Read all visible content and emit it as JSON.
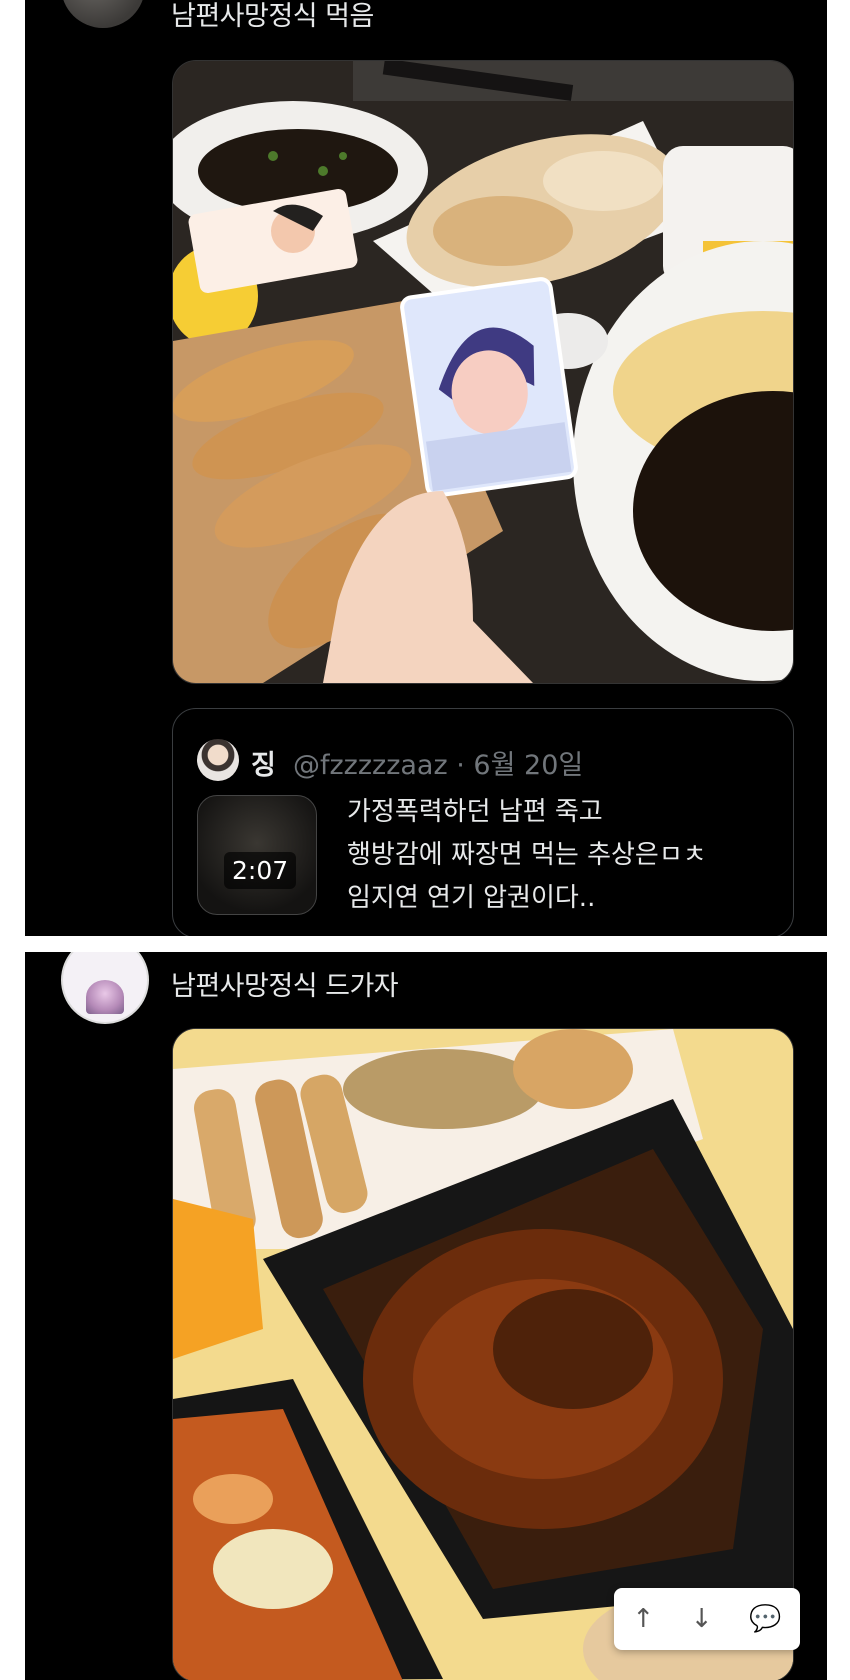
{
  "post1": {
    "text": "남편사망정식 먹음",
    "photo_subject": "food",
    "quote": {
      "name": "징",
      "handle": "@fzzzzzaaz",
      "separator": "·",
      "date": "6월 20일",
      "video_duration": "2:07",
      "lines": [
        "가정폭력하던 남편 죽고",
        "행방감에 짜장면 먹는 추상은ㅁㅊ",
        "임지연 연기 압권이다.."
      ]
    }
  },
  "post2": {
    "text": "남편사망정식 드가자",
    "photo_subject": "food"
  },
  "action_bar": {
    "up_icon": "arrow-up-icon",
    "down_icon": "arrow-down-icon",
    "comment_icon": "comment-icon"
  }
}
